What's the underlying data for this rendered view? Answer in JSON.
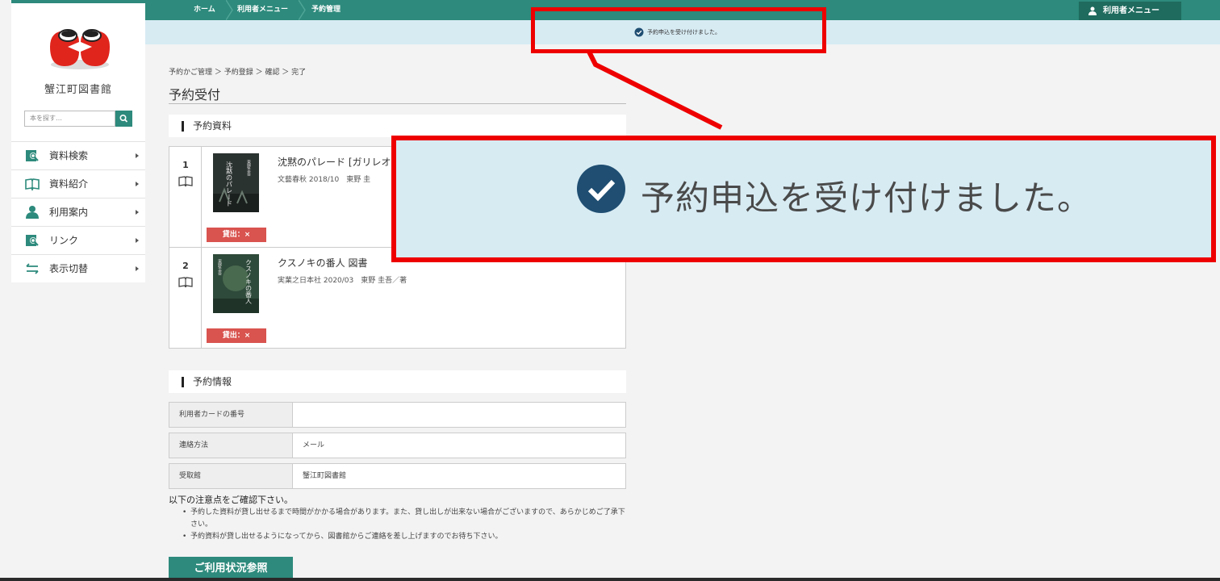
{
  "topnav": {
    "crumbs": [
      "ホーム",
      "利用者メニュー",
      "予約管理"
    ],
    "user_menu_label": "利用者メニュー"
  },
  "notice": {
    "message": "予約申込を受け付けました。"
  },
  "sidebar": {
    "library_name": "蟹江町図書館",
    "search_placeholder": "本を探す…",
    "items": [
      {
        "label": "資料検索",
        "icon": "search-book-icon"
      },
      {
        "label": "資料紹介",
        "icon": "open-book-icon"
      },
      {
        "label": "利用案内",
        "icon": "person-icon"
      },
      {
        "label": "リンク",
        "icon": "search-book-icon"
      },
      {
        "label": "表示切替",
        "icon": "swap-arrows-icon"
      }
    ]
  },
  "main": {
    "breadcrumb": "予約かご管理 ＞ 予約登録 ＞ 確認 ＞ 完了",
    "page_title": "予約受付",
    "materials_section": "予約資料",
    "items": [
      {
        "number": "1",
        "title": "沈黙のパレード [ガリレオ",
        "meta": "文藝春秋 2018/10　東野 圭",
        "cover_text": "沈黙のパレード",
        "cover_author": "東野圭吾",
        "loan_status": "貸出：×"
      },
      {
        "number": "2",
        "title": "クスノキの番人 図書",
        "meta": "実業之日本社 2020/03　東野 圭吾／著",
        "cover_text": "クスノキの番人",
        "cover_author": "東野圭吾",
        "loan_status": "貸出：×"
      }
    ],
    "info_section": "予約情報",
    "info_rows": [
      {
        "label": "利用者カードの番号",
        "value": ""
      },
      {
        "label": "連絡方法",
        "value": "メール"
      },
      {
        "label": "受取館",
        "value": "蟹江町図書館"
      }
    ],
    "notes_heading": "以下の注意点をご確認下さい。",
    "notes": [
      "予約した資料が貸し出せるまで時間がかかる場合があります。また、貸し出しが出来ない場合がございますので、あらかじめご了承下さい。",
      "予約資料が貸し出せるようになってから、図書館からご連絡を差し上げますのでお待ち下さい。"
    ],
    "status_button": "ご利用状況参照"
  },
  "callout": {
    "message": "予約申込を受け付けました。",
    "color": "#ee0000"
  },
  "colors": {
    "brand": "#2d8a7c",
    "notice_bg": "#d7ebf3",
    "badge": "#d9534f"
  }
}
